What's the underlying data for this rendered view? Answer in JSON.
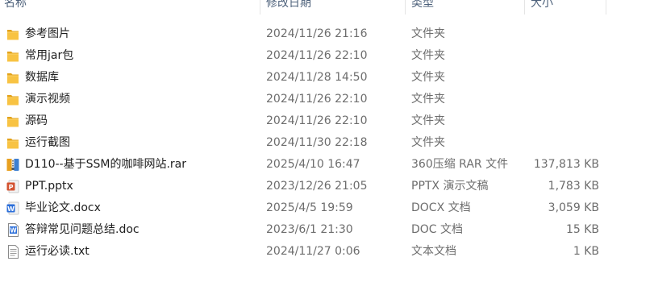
{
  "columns": {
    "name": "名称",
    "date": "修改日期",
    "type": "类型",
    "size": "大小"
  },
  "files": [
    {
      "icon": "folder-icon",
      "name": "参考图片",
      "date": "2024/11/26 21:16",
      "type": "文件夹",
      "size": ""
    },
    {
      "icon": "folder-icon",
      "name": "常用jar包",
      "date": "2024/11/26 22:10",
      "type": "文件夹",
      "size": ""
    },
    {
      "icon": "folder-icon",
      "name": "数据库",
      "date": "2024/11/28 14:50",
      "type": "文件夹",
      "size": ""
    },
    {
      "icon": "folder-icon",
      "name": "演示视频",
      "date": "2024/11/26 22:10",
      "type": "文件夹",
      "size": ""
    },
    {
      "icon": "folder-icon",
      "name": "源码",
      "date": "2024/11/26 22:10",
      "type": "文件夹",
      "size": ""
    },
    {
      "icon": "folder-icon",
      "name": "运行截图",
      "date": "2024/11/30 22:18",
      "type": "文件夹",
      "size": ""
    },
    {
      "icon": "rar-archive-icon",
      "name": "D110--基于SSM的咖啡网站.rar",
      "date": "2025/4/10 16:47",
      "type": "360压缩 RAR 文件",
      "size": "137,813 KB"
    },
    {
      "icon": "powerpoint-icon",
      "name": "PPT.pptx",
      "date": "2023/12/26 21:05",
      "type": "PPTX 演示文稿",
      "size": "1,783 KB"
    },
    {
      "icon": "word-docx-icon",
      "name": "毕业论文.docx",
      "date": "2025/4/5 19:59",
      "type": "DOCX 文档",
      "size": "3,059 KB"
    },
    {
      "icon": "word-doc-icon",
      "name": "答辩常见问题总结.doc",
      "date": "2023/6/1 21:30",
      "type": "DOC 文档",
      "size": "15 KB"
    },
    {
      "icon": "text-file-icon",
      "name": "运行必读.txt",
      "date": "2024/11/27 0:06",
      "type": "文本文档",
      "size": "1 KB"
    }
  ],
  "colors": {
    "folder": "#f8c343",
    "folder_dark": "#e3a21a",
    "ppt": "#d35230",
    "word": "#2b6ed9",
    "header_text": "#4c607a",
    "secondary_text": "#6d6d6d"
  }
}
